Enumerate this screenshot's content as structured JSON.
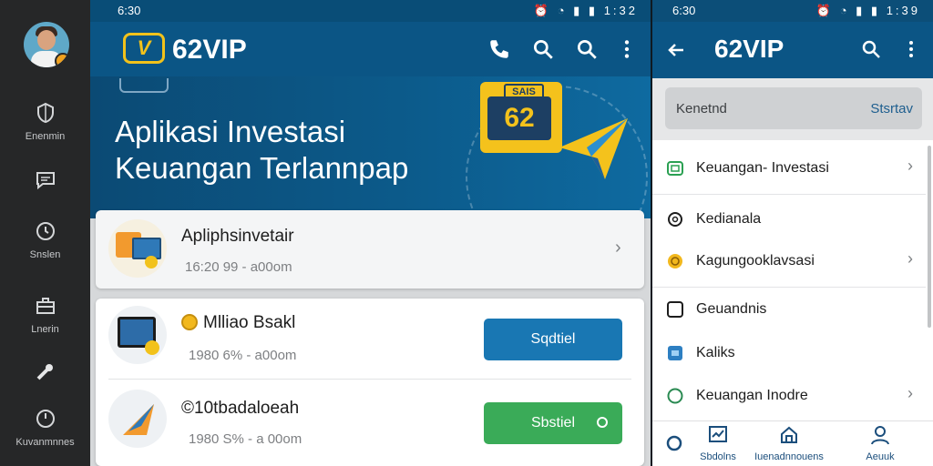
{
  "rail": {
    "items": [
      {
        "label": "Enenmin",
        "icon": "shield-icon"
      },
      {
        "label": "",
        "icon": "chat-icon"
      },
      {
        "label": "Snslen",
        "icon": "clock-icon"
      },
      {
        "label": "Lnerin",
        "icon": "briefcase-icon"
      },
      {
        "label": "",
        "icon": "tools-icon"
      },
      {
        "label": "Kuvanmnnes",
        "icon": "timer-icon"
      }
    ]
  },
  "main": {
    "status": {
      "time": "6:30",
      "right": "1:32"
    },
    "brand": "62VIP",
    "logo_text": "V",
    "hero": {
      "line1": "Aplikasi Investasi",
      "line2": "Keuangan Terlannpap",
      "sign_tag": "SAIS",
      "sign_text": "62"
    },
    "cards": [
      {
        "title": "Apliphsinvetair",
        "sub": "16:20 99 - a00om"
      },
      {
        "title": "Mlliao Bsakl",
        "sub": "1980 6% - a00om",
        "button": "Sqdtiel"
      },
      {
        "title": "©10tbadaloeah",
        "sub": "1980 S% - a 00om",
        "button": "Sbstiel"
      }
    ]
  },
  "right": {
    "status": {
      "time": "6:30",
      "right": "1:39"
    },
    "brand": "62VIP",
    "search": {
      "placeholder": "Kenetnd",
      "action": "Stsrtav"
    },
    "rows": [
      {
        "label": "Keuangan- Investasi",
        "icon": "wallet-icon",
        "chevron": true
      },
      {
        "label": "Kedianala",
        "icon": "info-circle-icon",
        "chevron": false
      },
      {
        "label": "Kagungooklavsasi",
        "icon": "coin-icon",
        "chevron": true
      },
      {
        "label": "Geuandnis",
        "icon": "square-s-icon",
        "chevron": false
      },
      {
        "label": "Kaliks",
        "icon": "app-icon",
        "chevron": false
      },
      {
        "label": "Keuangan Inodre",
        "icon": "circle-icon",
        "chevron": true
      }
    ],
    "bottom_nav": [
      {
        "label": "",
        "icon": "circle-o-icon"
      },
      {
        "label": "Sbdolns",
        "icon": "chart-icon"
      },
      {
        "label": "Iuenadnnouens",
        "icon": "home-icon"
      },
      {
        "label": "Aeuuk",
        "icon": "person-icon"
      }
    ]
  },
  "colors": {
    "primary": "#0b5585",
    "accent": "#f2c21b",
    "blue_button": "#1977b3",
    "green_button": "#3aab58"
  }
}
